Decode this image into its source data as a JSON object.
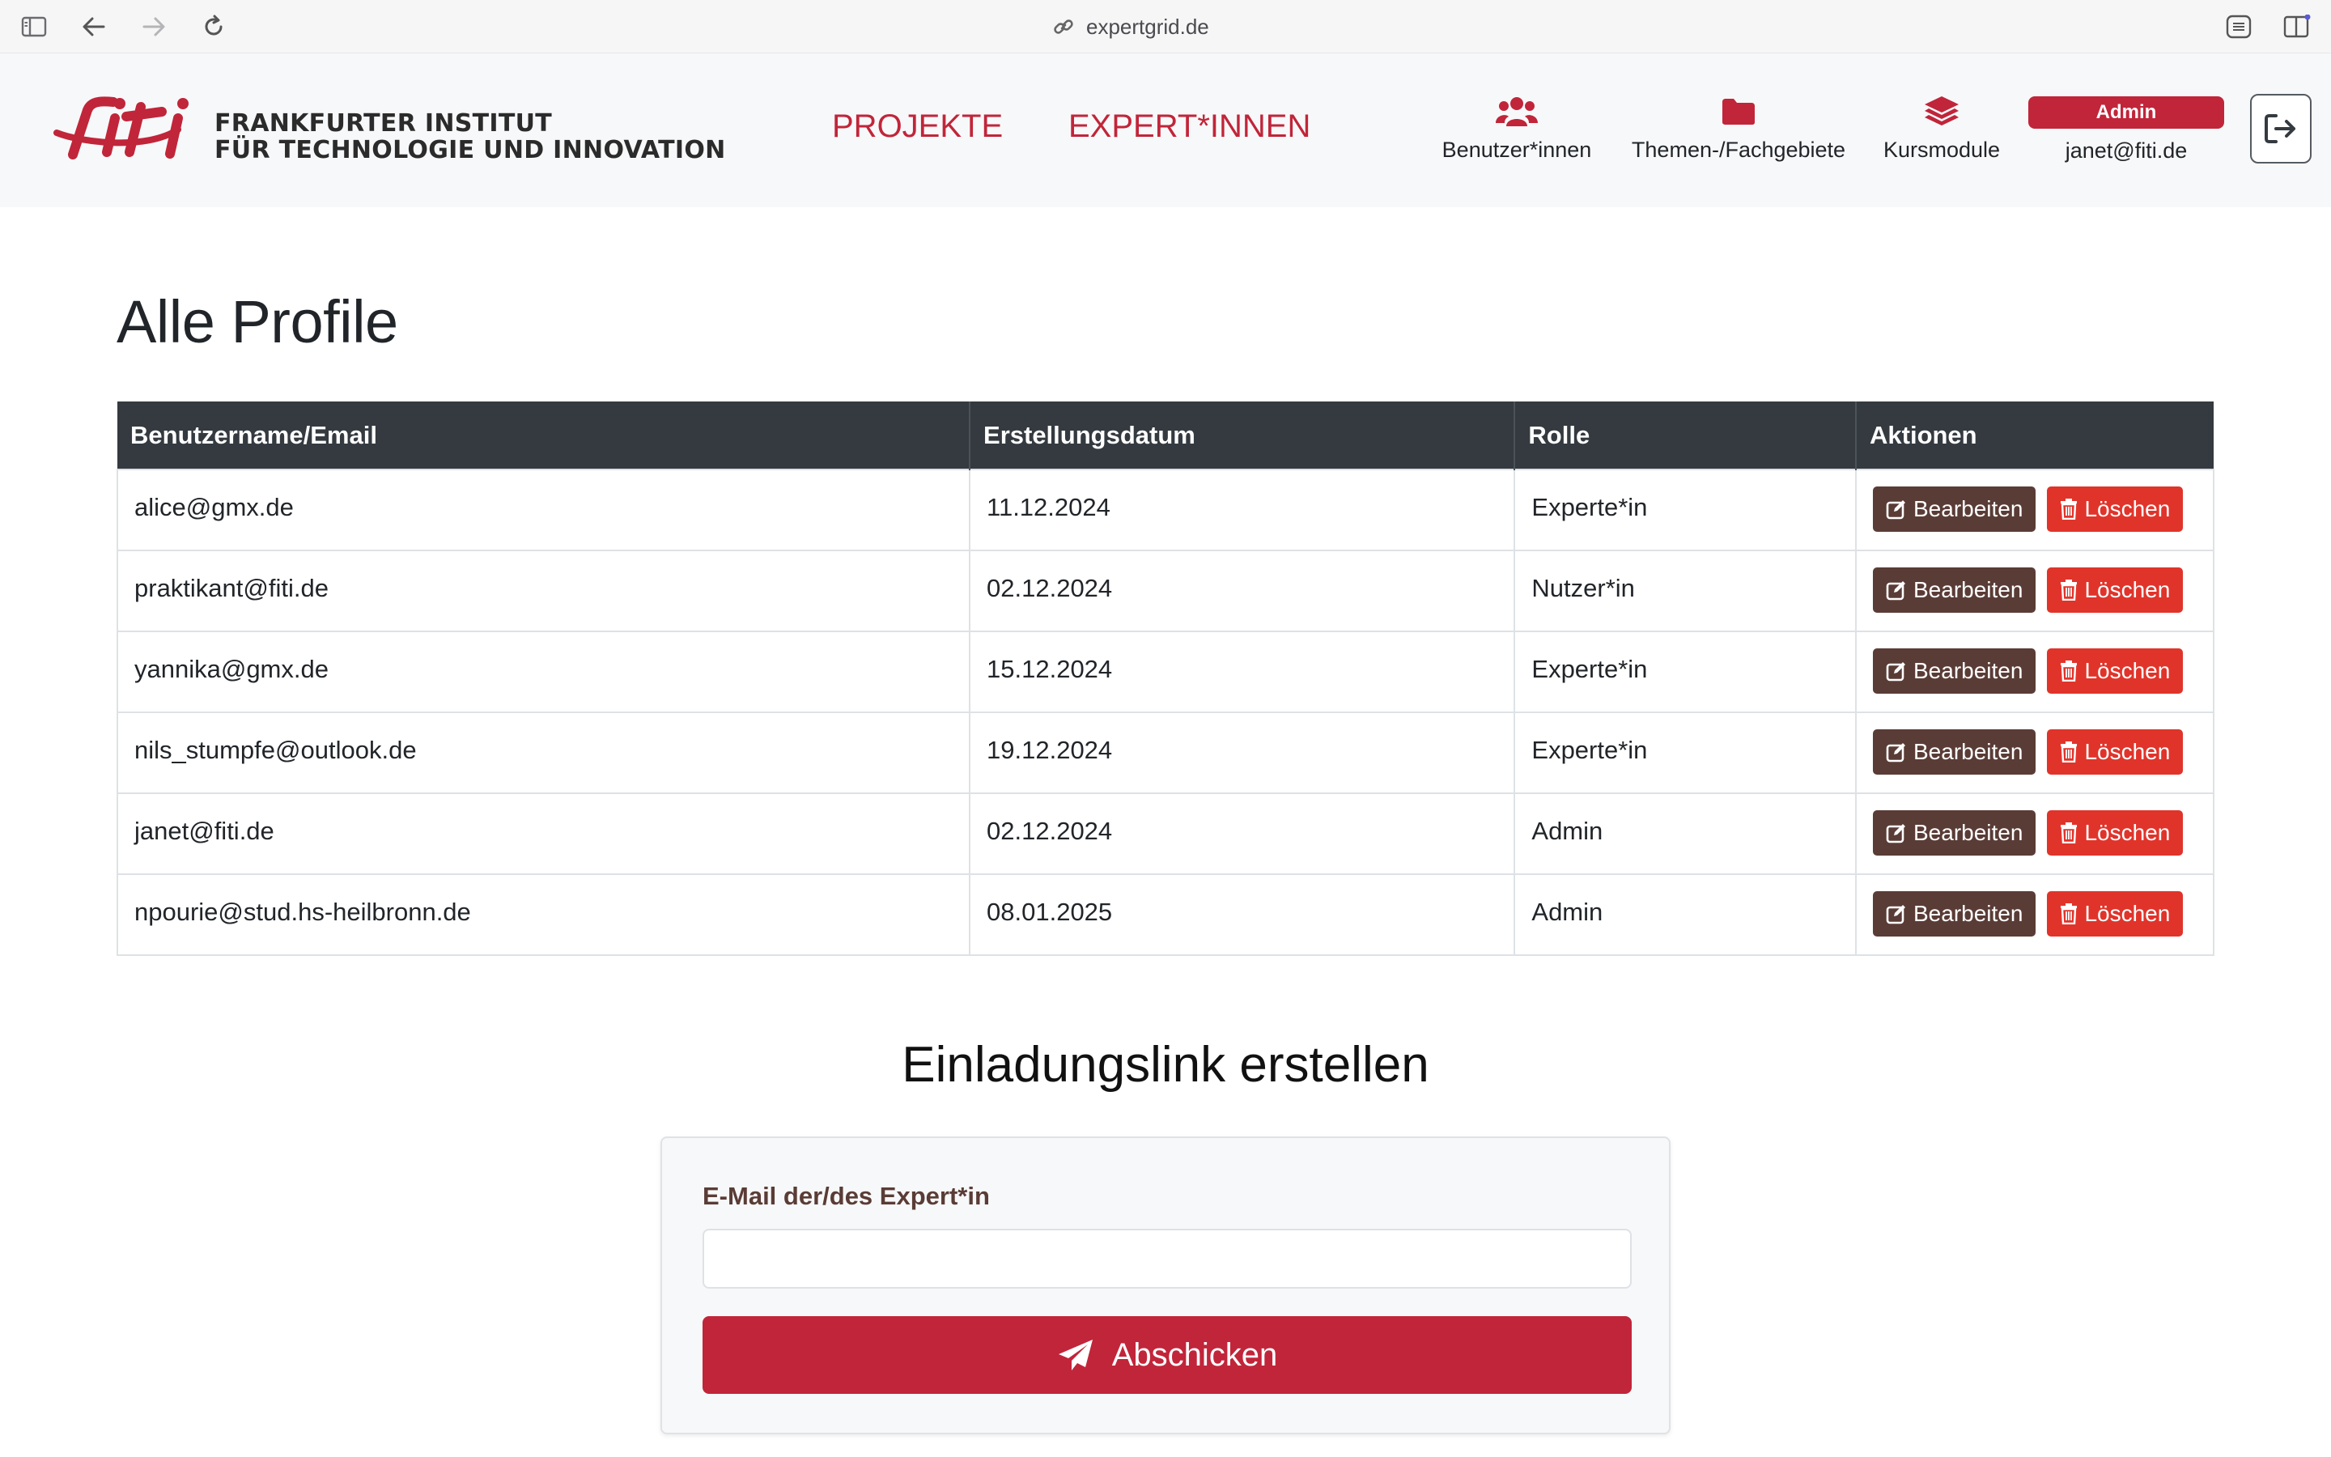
{
  "browser": {
    "url": "expertgrid.de"
  },
  "header": {
    "logo_line1": "FRANKFURTER INSTITUT",
    "logo_line2": "FÜR TECHNOLOGIE UND INNOVATION",
    "nav": [
      {
        "label": "PROJEKTE"
      },
      {
        "label": "EXPERT*INNEN"
      }
    ],
    "icon_nav": [
      {
        "label": "Benutzer*innen",
        "icon": "users-icon"
      },
      {
        "label": "Themen-/Fachgebiete",
        "icon": "folder-icon"
      },
      {
        "label": "Kursmodule",
        "icon": "layers-icon"
      }
    ],
    "role_badge": "Admin",
    "user_email": "janet@fiti.de",
    "accent_color": "#c1253a"
  },
  "page": {
    "title": "Alle Profile"
  },
  "table": {
    "headers": [
      "Benutzername/Email",
      "Erstellungsdatum",
      "Rolle",
      "Aktionen"
    ],
    "edit_label": "Bearbeiten",
    "delete_label": "Löschen",
    "rows": [
      {
        "email": "alice@gmx.de",
        "date": "11.12.2024",
        "role": "Experte*in"
      },
      {
        "email": "praktikant@fiti.de",
        "date": "02.12.2024",
        "role": "Nutzer*in"
      },
      {
        "email": "yannika@gmx.de",
        "date": "15.12.2024",
        "role": "Experte*in"
      },
      {
        "email": "nils_stumpfe@outlook.de",
        "date": "19.12.2024",
        "role": "Experte*in"
      },
      {
        "email": "janet@fiti.de",
        "date": "02.12.2024",
        "role": "Admin"
      },
      {
        "email": "npourie@stud.hs-heilbronn.de",
        "date": "08.01.2025",
        "role": "Admin"
      }
    ]
  },
  "invite": {
    "title": "Einladungslink erstellen",
    "label": "E-Mail der/des Expert*in",
    "value": "",
    "submit_label": "Abschicken"
  }
}
